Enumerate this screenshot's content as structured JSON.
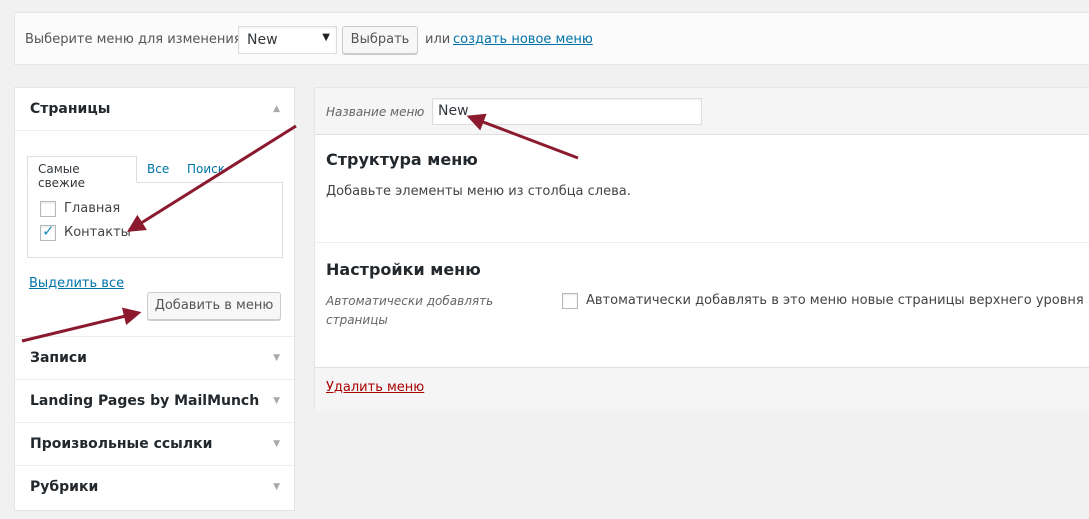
{
  "top": {
    "select_label": "Выберите меню для изменения:",
    "selected_menu": "New",
    "choose_button": "Выбрать",
    "or_text": "или",
    "create_link": "создать новое меню",
    "period": "."
  },
  "left_panel": {
    "pages_title": "Страницы",
    "tabs": [
      "Самые свежие",
      "Все",
      "Поиск"
    ],
    "pages": [
      {
        "label": "Главная",
        "checked": false
      },
      {
        "label": "Контакты",
        "checked": true
      }
    ],
    "select_all": "Выделить все",
    "add_button": "Добавить в меню",
    "sections": [
      "Записи",
      "Landing Pages by MailMunch",
      "Произвольные ссылки",
      "Рубрики"
    ]
  },
  "right_panel": {
    "name_label": "Название меню",
    "name_value": "New",
    "structure_title": "Структура меню",
    "structure_desc": "Добавьте элементы меню из столбца слева.",
    "settings_title": "Настройки меню",
    "auto_add_label": "Автоматически добавлять страницы",
    "auto_add_text": "Автоматически добавлять в это меню новые страницы верхнего уровня",
    "delete_link": "Удалить меню"
  },
  "colors": {
    "link": "#0073aa",
    "delete": "#aa0000",
    "annotation_arrow": "#8b1a2f"
  }
}
